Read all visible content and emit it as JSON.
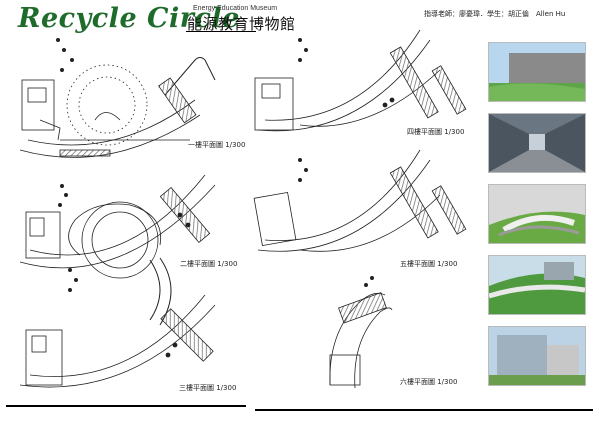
{
  "header": {
    "logo_text": "Recycle Circle",
    "subtitle_en": "Energy Education Museum",
    "subtitle_zh": "能源教育博物館",
    "credit": "指導老師：廖憂瑋．學生：胡正倫　Allen Hu"
  },
  "plans": [
    {
      "label": "一樓平面圖 1/300"
    },
    {
      "label": "二樓平面圖 1/300"
    },
    {
      "label": "三樓平面圖 1/300"
    },
    {
      "label": "四樓平面圖 1/300"
    },
    {
      "label": "五樓平面圖 1/300"
    },
    {
      "label": "六樓平面圖 1/300"
    }
  ],
  "renders": [
    {
      "name": "exterior-day-view"
    },
    {
      "name": "interior-corridor-view"
    },
    {
      "name": "plaza-aerial-view"
    },
    {
      "name": "green-roof-view"
    },
    {
      "name": "street-view"
    }
  ],
  "colors": {
    "logo": "#1f6b2c",
    "line": "#222222",
    "hatch": "#555555"
  }
}
